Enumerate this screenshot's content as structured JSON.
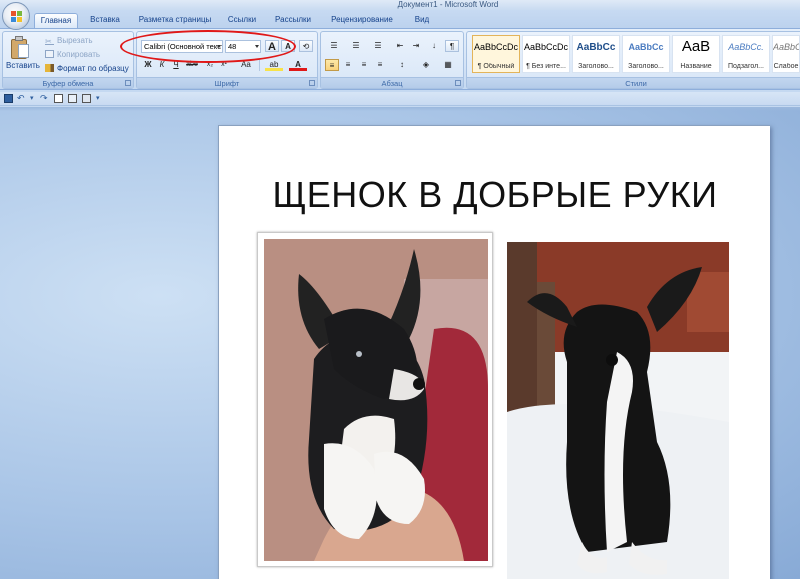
{
  "window": {
    "title": "Документ1 - Microsoft Word"
  },
  "tabs": [
    {
      "label": "Главная"
    },
    {
      "label": "Вставка"
    },
    {
      "label": "Разметка страницы"
    },
    {
      "label": "Ссылки"
    },
    {
      "label": "Рассылки"
    },
    {
      "label": "Рецензирование"
    },
    {
      "label": "Вид"
    }
  ],
  "clipboard": {
    "paste": "Вставить",
    "cut": "Вырезать",
    "copy": "Копировать",
    "format_painter": "Формат по образцу",
    "label": "Буфер обмена"
  },
  "font": {
    "family": "Calibri (Основной текст)",
    "size": "48",
    "label": "Шрифт",
    "bold": "Ж",
    "italic": "К",
    "underline": "Ч",
    "grow": "A",
    "shrink": "A",
    "strike": "abe",
    "change_case": "Aa",
    "color": "A"
  },
  "paragraph": {
    "label": "Абзац",
    "show_marks": "¶"
  },
  "styles": {
    "label": "Стили",
    "items": [
      {
        "sample": "AaBbCcDc",
        "name": "¶ Обычный",
        "selected": true
      },
      {
        "sample": "AaBbCcDc",
        "name": "¶ Без инте..."
      },
      {
        "sample": "AaBbCc",
        "name": "Заголово..."
      },
      {
        "sample": "AaBbCc",
        "name": "Заголово..."
      },
      {
        "sample": "AaB",
        "name": "Название"
      },
      {
        "sample": "AaBbCc.",
        "name": "Подзагол..."
      },
      {
        "sample": "AaBbCcD",
        "name": "Слабое"
      }
    ]
  },
  "document": {
    "heading": "ЩЕНОК В ДОБРЫЕ РУКИ"
  },
  "colors": {
    "annotation": "#e01818",
    "font_color": "#e01818",
    "highlight": "#f7e24a"
  }
}
